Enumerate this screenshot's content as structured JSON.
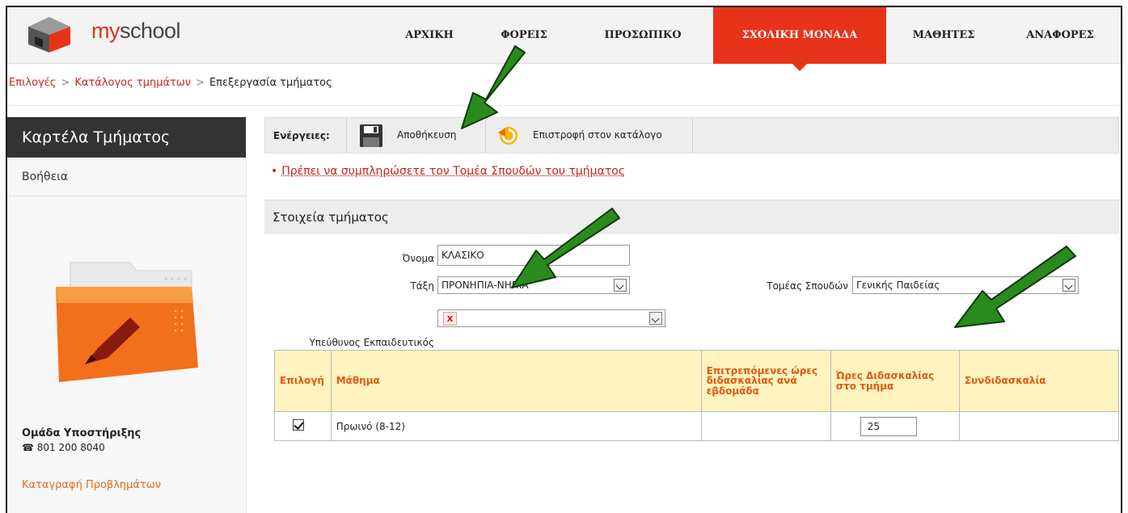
{
  "brand": {
    "prefix": "my",
    "suffix": "school"
  },
  "nav": [
    "ΑΡΧΙΚΗ",
    "ΦΟΡΕΙΣ",
    "ΠΡΟΣΩΠΙΚΟ",
    "ΣΧΟΛΙΚΗ ΜΟΝΑΔΑ",
    "ΜΑΘΗΤΕΣ",
    "ΑΝΑΦΟΡΕΣ"
  ],
  "nav_active": "ΣΧΟΛΙΚΗ ΜΟΝΑΔΑ",
  "breadcrumb": {
    "items": [
      "Επιλογές",
      "Κατάλογος τμημάτων"
    ],
    "separator": ">",
    "current": "Επεξεργασία τμήματος"
  },
  "sidebar": {
    "title": "Καρτέλα Τμήματος",
    "help": "Βοήθεια",
    "support_title": "Ομάδα Υποστήριξης",
    "phone": "801 200 8040",
    "report_link": "Καταγραφή Προβλημάτων"
  },
  "toolbar": {
    "label": "Ενέργειες:",
    "save": "Αποθήκευση",
    "back": "Επιστροφή στον κατάλογο"
  },
  "error": "Πρέπει να συμπληρώσετε τον Τομέα Σπουδών του τμήματος",
  "section_title": "Στοιχεία τμήματος",
  "form": {
    "name_label": "Όνομα",
    "name_value": "ΚΛΑΣΙΚΟ",
    "class_label": "Τάξη",
    "class_value": "ΠΡΟΝΗΠΙΑ-ΝΗΠΙΑ",
    "field_label": "Τομέας Σπουδών",
    "field_value": "Γενικής Παιδείας",
    "teacher_label": "Υπεύθυνος Εκπαιδευτικός",
    "teacher_badge": "x"
  },
  "table": {
    "headers": [
      "Επιλογή",
      "Μάθημα",
      "Επιτρεπόμενες ώρες διδασκαλίας ανά εβδομάδα",
      "Ώρες Διδασκαλίας στο τμήμα",
      "Συνδιδασκαλία"
    ],
    "rows": [
      {
        "selected": true,
        "course": "Πρωινό (8-12)",
        "allowed": "",
        "hours": "25",
        "co_teaching": ""
      }
    ]
  },
  "colors": {
    "accent": "#e8331b",
    "link": "#c8281a",
    "header_bg": "#fff3c0",
    "arrow": "#2a8a1e"
  }
}
